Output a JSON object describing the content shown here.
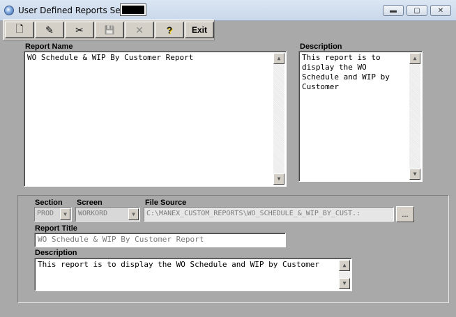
{
  "window": {
    "title": "User Defined Reports Setup",
    "controls": {
      "minimize": "▬",
      "maximize": "▢",
      "close": "✕"
    }
  },
  "toolbar": {
    "new_icon": "🗋",
    "edit_icon": "✎",
    "cut_icon": "✂",
    "save_icon": "💾",
    "delete_icon": "✕",
    "help_icon": "?",
    "exit_label": "Exit"
  },
  "top": {
    "report_name_label": "Report Name",
    "report_name_value": "WO Schedule & WIP By Customer Report",
    "description_label": "Description",
    "description_value": "This report is to display the WO Schedule and WIP by Customer"
  },
  "details": {
    "section_label": "Section",
    "section_value": "PROD",
    "screen_label": "Screen",
    "screen_value": "WORKORD",
    "file_source_label": "File Source",
    "file_source_value": "C:\\MANEX_CUSTOM_REPORTS\\WO_SCHEDULE_&_WIP_BY_CUST.:",
    "browse_label": "...",
    "report_title_label": "Report Title",
    "report_title_value": "WO Schedule & WIP By Customer Report",
    "description_label": "Description",
    "description_value": "This report is to display the WO Schedule and WIP by Customer"
  },
  "glyphs": {
    "up": "▲",
    "down": "▼"
  }
}
